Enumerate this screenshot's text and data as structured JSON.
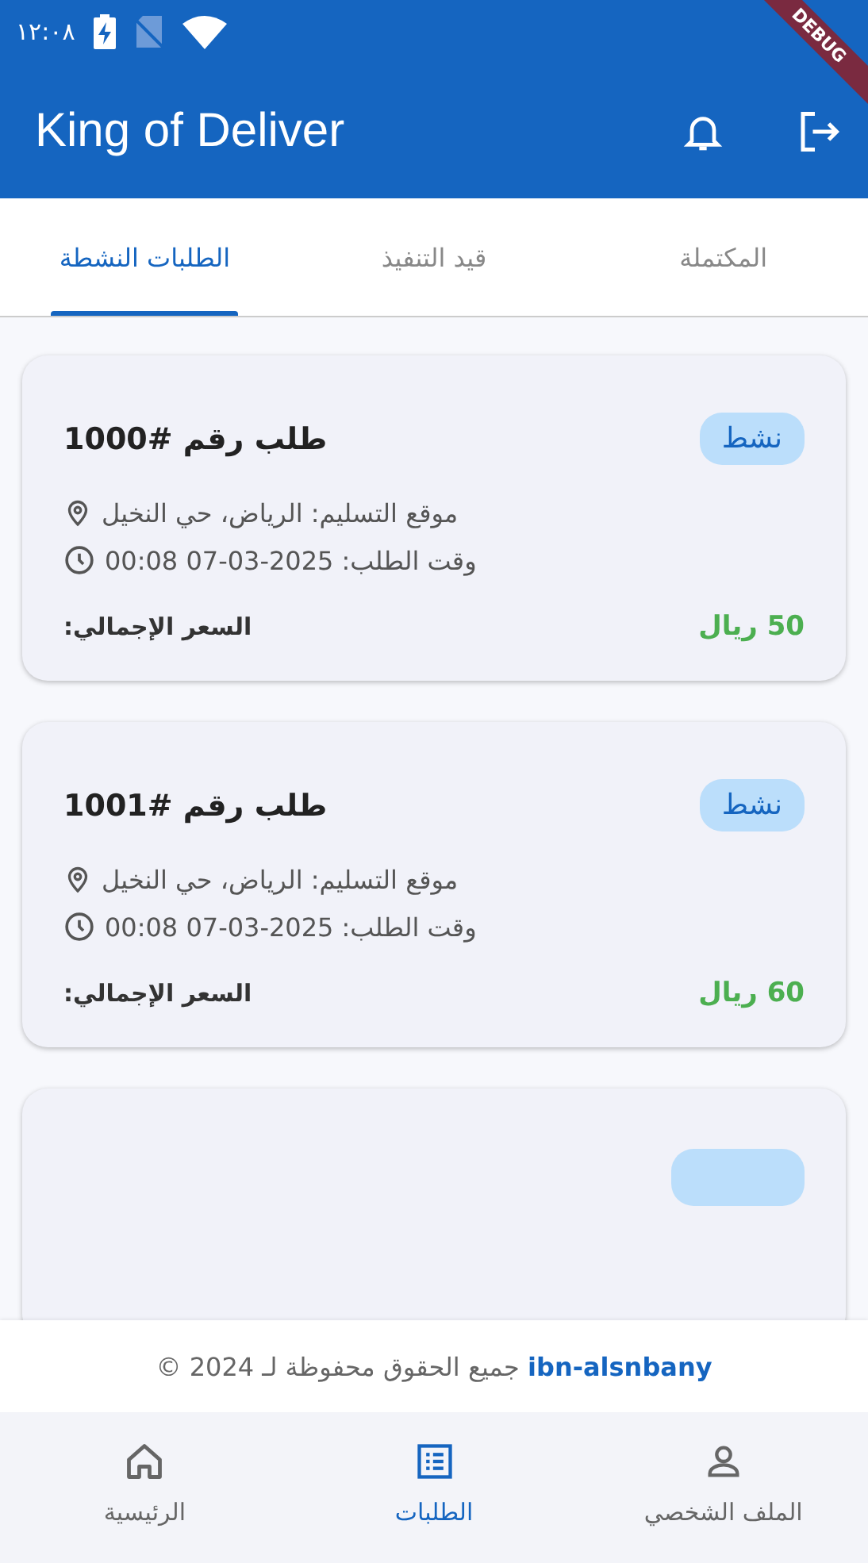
{
  "status_bar": {
    "time": "١٢:٠٨"
  },
  "debug_banner": "DEBUG",
  "app_bar": {
    "title": "King of Deliver"
  },
  "tabs": [
    {
      "label": "المكتملة",
      "selected": false
    },
    {
      "label": "قيد التنفيذ",
      "selected": false
    },
    {
      "label": "الطلبات النشطة",
      "selected": true
    }
  ],
  "orders": [
    {
      "kind": "full",
      "title": "طلب رقم #1000",
      "status": "نشط",
      "location": "موقع التسليم: الرياض، حي النخيل",
      "time": "وقت الطلب: 2025-03-07 00:08",
      "price_label": "السعر الإجمالي:",
      "price": "50 ريال"
    },
    {
      "kind": "full",
      "title": "طلب رقم #1001",
      "status": "نشط",
      "location": "موقع التسليم: الرياض، حي النخيل",
      "time": "وقت الطلب: 2025-03-07 00:08",
      "price_label": "السعر الإجمالي:",
      "price": "60 ريال"
    },
    {
      "kind": "partial"
    }
  ],
  "footer": {
    "owner": "ibn-alsnbany",
    "text": "جميع الحقوق محفوظة لـ 2024 ©"
  },
  "bottom_nav": [
    {
      "label": "الملف الشخصي",
      "kind": "person",
      "selected": false
    },
    {
      "label": "الطلبات",
      "kind": "list",
      "selected": true
    },
    {
      "label": "الرئيسية",
      "kind": "home",
      "selected": false
    }
  ]
}
